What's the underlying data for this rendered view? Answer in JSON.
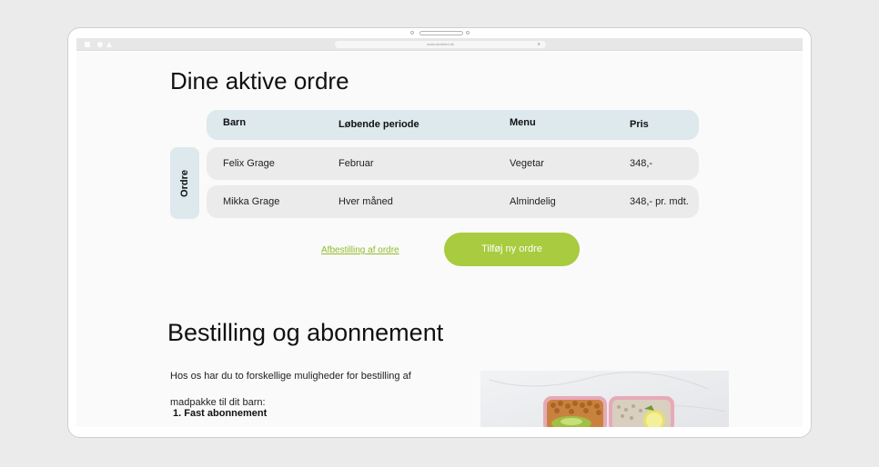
{
  "browser": {
    "url": "www.skoleted.dk"
  },
  "orders": {
    "title": "Dine aktive ordre",
    "side_label": "Ordre",
    "columns": [
      "Barn",
      "Løbende periode",
      "Menu",
      "Pris"
    ],
    "rows": [
      [
        "Felix Grage",
        "Februar",
        "Vegetar",
        "348,-"
      ],
      [
        "Mikka Grage",
        "Hver måned",
        "Almindelig",
        "348,- pr. mdt."
      ]
    ],
    "cancel_link": "Afbestilling af ordre",
    "add_button": "Tilføj ny ordre"
  },
  "subscription": {
    "title": "Bestilling og abonnement",
    "intro": "Hos os har du to forskellige muligheder for bestilling af madpakke til dit barn:",
    "list": [
      "1. Fast abonnement"
    ]
  },
  "colors": {
    "accent_green": "#a8cb3f",
    "link_green": "#8ebc2b",
    "header_blue": "#dde9ec",
    "row_grey": "#ebebeb"
  }
}
